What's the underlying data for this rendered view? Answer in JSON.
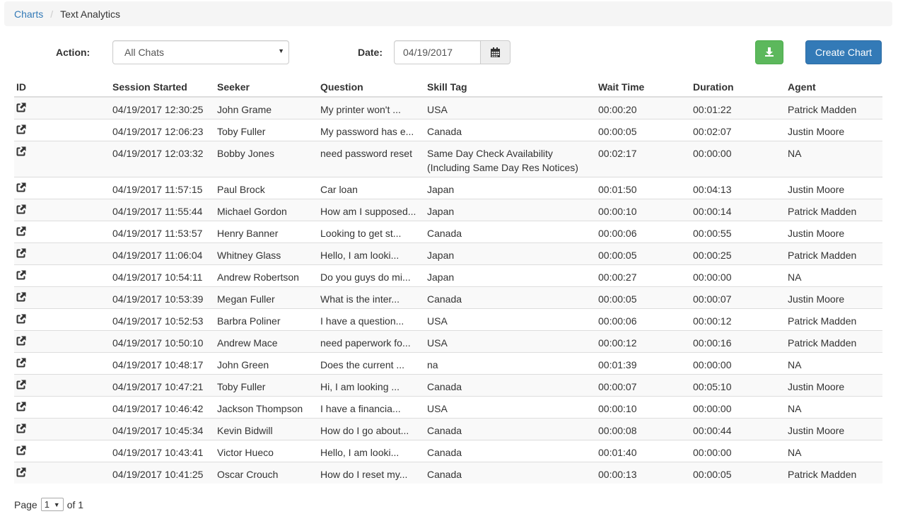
{
  "breadcrumb": {
    "root": "Charts",
    "current": "Text Analytics"
  },
  "filters": {
    "action_label": "Action:",
    "action_value": "All Chats",
    "date_label": "Date:",
    "date_value": "04/19/2017"
  },
  "buttons": {
    "download_icon": "download-icon",
    "create_chart": "Create Chart"
  },
  "table": {
    "headers": [
      "ID",
      "Session Started",
      "Seeker",
      "Question",
      "Skill Tag",
      "Wait Time",
      "Duration",
      "Agent"
    ],
    "rows": [
      {
        "started": "04/19/2017 12:30:25",
        "seeker": "John Grame",
        "question": "My printer won't ...",
        "skill": "USA",
        "wait": "00:00:20",
        "duration": "00:01:22",
        "agent": "Patrick Madden"
      },
      {
        "started": "04/19/2017 12:06:23",
        "seeker": "Toby Fuller",
        "question": "My password has e...",
        "skill": "Canada",
        "wait": "00:00:05",
        "duration": "00:02:07",
        "agent": "Justin Moore"
      },
      {
        "started": "04/19/2017 12:03:32",
        "seeker": "Bobby Jones",
        "question": "need password reset",
        "skill": "Same Day Check Availability (Including Same Day Res Notices)",
        "wait": "00:02:17",
        "duration": "00:00:00",
        "agent": "NA"
      },
      {
        "started": "04/19/2017 11:57:15",
        "seeker": "Paul Brock",
        "question": "Car loan",
        "skill": "Japan",
        "wait": "00:01:50",
        "duration": "00:04:13",
        "agent": "Justin Moore"
      },
      {
        "started": "04/19/2017 11:55:44",
        "seeker": "Michael Gordon",
        "question": "How am I supposed...",
        "skill": "Japan",
        "wait": "00:00:10",
        "duration": "00:00:14",
        "agent": "Patrick Madden"
      },
      {
        "started": "04/19/2017 11:53:57",
        "seeker": "Henry Banner",
        "question": "Looking to get st...",
        "skill": "Canada",
        "wait": "00:00:06",
        "duration": "00:00:55",
        "agent": "Justin Moore"
      },
      {
        "started": "04/19/2017 11:06:04",
        "seeker": "Whitney Glass",
        "question": "Hello, I am looki...",
        "skill": "Japan",
        "wait": "00:00:05",
        "duration": "00:00:25",
        "agent": "Patrick Madden"
      },
      {
        "started": "04/19/2017 10:54:11",
        "seeker": "Andrew Robertson",
        "question": "Do you guys do mi...",
        "skill": "Japan",
        "wait": "00:00:27",
        "duration": "00:00:00",
        "agent": "NA"
      },
      {
        "started": "04/19/2017 10:53:39",
        "seeker": "Megan Fuller",
        "question": "What is the inter...",
        "skill": "Canada",
        "wait": "00:00:05",
        "duration": "00:00:07",
        "agent": "Justin Moore"
      },
      {
        "started": "04/19/2017 10:52:53",
        "seeker": "Barbra Poliner",
        "question": "I have a question...",
        "skill": "USA",
        "wait": "00:00:06",
        "duration": "00:00:12",
        "agent": "Patrick Madden"
      },
      {
        "started": "04/19/2017 10:50:10",
        "seeker": "Andrew Mace",
        "question": "need paperwork fo...",
        "skill": "USA",
        "wait": "00:00:12",
        "duration": "00:00:16",
        "agent": "Patrick Madden"
      },
      {
        "started": "04/19/2017 10:48:17",
        "seeker": "John Green",
        "question": "Does the current ...",
        "skill": "na",
        "wait": "00:01:39",
        "duration": "00:00:00",
        "agent": "NA"
      },
      {
        "started": "04/19/2017 10:47:21",
        "seeker": "Toby Fuller",
        "question": "Hi, I am looking ...",
        "skill": "Canada",
        "wait": "00:00:07",
        "duration": "00:05:10",
        "agent": "Justin Moore"
      },
      {
        "started": "04/19/2017 10:46:42",
        "seeker": "Jackson Thompson",
        "question": "I have a financia...",
        "skill": "USA",
        "wait": "00:00:10",
        "duration": "00:00:00",
        "agent": "NA"
      },
      {
        "started": "04/19/2017 10:45:34",
        "seeker": "Kevin Bidwill",
        "question": "How do I go about...",
        "skill": "Canada",
        "wait": "00:00:08",
        "duration": "00:00:44",
        "agent": "Justin Moore"
      },
      {
        "started": "04/19/2017 10:43:41",
        "seeker": "Victor Hueco",
        "question": "Hello, I am looki...",
        "skill": "Canada",
        "wait": "00:01:40",
        "duration": "00:00:00",
        "agent": "NA"
      },
      {
        "started": "04/19/2017 10:41:25",
        "seeker": "Oscar Crouch",
        "question": "How do I reset my...",
        "skill": "Canada",
        "wait": "00:00:13",
        "duration": "00:00:05",
        "agent": "Patrick Madden"
      }
    ]
  },
  "pager": {
    "prefix": "Page",
    "current": "1",
    "suffix": "of 1"
  },
  "colors": {
    "link": "#337ab7",
    "success": "#5cb85c",
    "primary": "#337ab7",
    "stripe": "#f9f9f9"
  }
}
